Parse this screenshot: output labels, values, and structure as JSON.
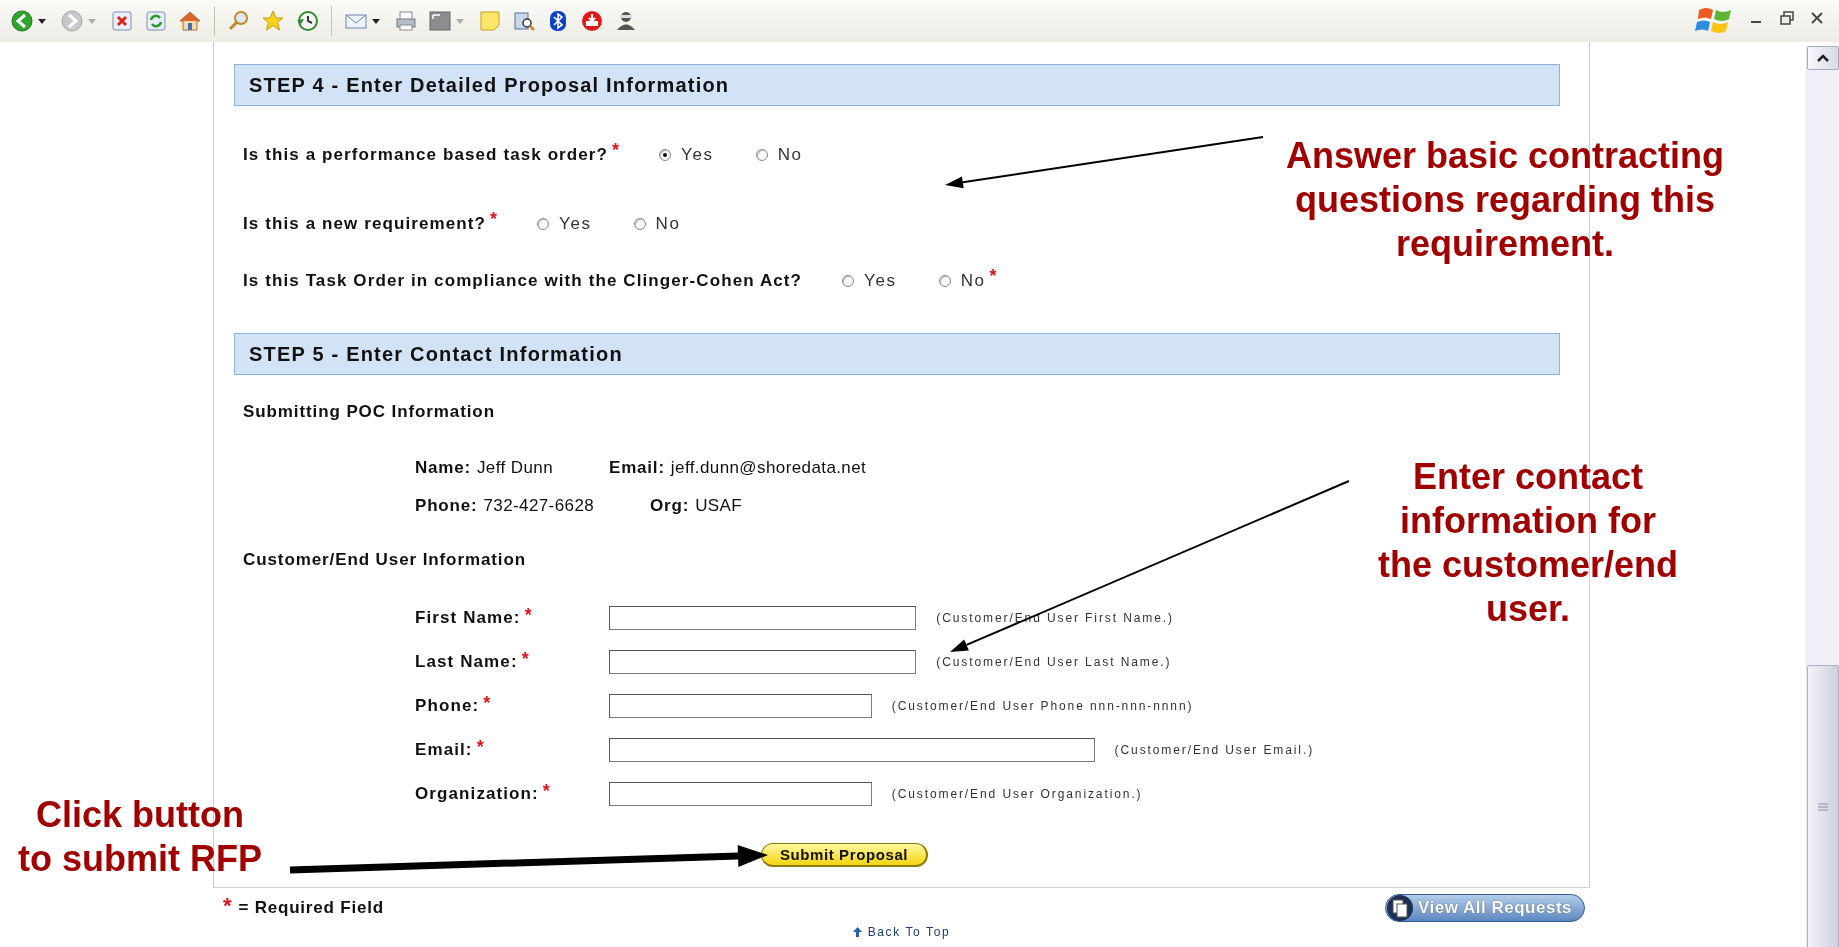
{
  "step4": {
    "title": "STEP 4 - Enter Detailed Proposal Information",
    "questions": [
      {
        "text": "Is this a performance based task order?",
        "mark": "*",
        "options": [
          {
            "label": "Yes",
            "selected": true
          },
          {
            "label": "No",
            "selected": false
          }
        ]
      },
      {
        "text": "Is this a new requirement?",
        "mark": "*",
        "options": [
          {
            "label": "Yes",
            "selected": false
          },
          {
            "label": "No",
            "selected": false
          }
        ]
      },
      {
        "text": "Is this Task Order in compliance with the Clinger-Cohen Act?",
        "options": [
          {
            "label": "Yes",
            "selected": false
          },
          {
            "label": "No",
            "selected": false
          }
        ],
        "options_mark": "*"
      }
    ]
  },
  "step5": {
    "title": "STEP 5 - Enter Contact Information",
    "poc": {
      "heading": "Submitting POC Information",
      "rows": [
        [
          {
            "label": "Name:",
            "value": "Jeff Dunn"
          },
          {
            "label": "Email:",
            "value": "jeff.dunn@shoredata.net"
          }
        ],
        [
          {
            "label": "Phone:",
            "value": "732-427-6628"
          },
          {
            "label": "Org:",
            "value": "USAF"
          }
        ]
      ]
    },
    "customer": {
      "heading": "Customer/End User Information",
      "fields": [
        {
          "label": "First Name:",
          "mark": "*",
          "hint": "(Customer/End User First Name.)"
        },
        {
          "label": "Last Name:",
          "mark": "*",
          "hint": "(Customer/End User Last Name.)"
        },
        {
          "label": "Phone:",
          "mark": "*",
          "hint": "(Customer/End User Phone nnn-nnn-nnnn)"
        },
        {
          "label": "Email:",
          "mark": "*",
          "hint": "(Customer/End User Email.)"
        },
        {
          "label": "Organization:",
          "mark": "*",
          "hint": "(Customer/End User Organization.)"
        }
      ]
    },
    "submit_button": "Submit Proposal"
  },
  "legend": {
    "mark": "*",
    "text": "= Required Field"
  },
  "view_all_button": "View All Requests",
  "back_to_top": "Back To Top",
  "annotations": [
    {
      "text": "Answer basic contracting\nquestions regarding this\nrequirement."
    },
    {
      "text": "Enter contact\ninformation for\nthe customer/end\nuser."
    },
    {
      "text": "Click button\nto submit RFP"
    }
  ]
}
